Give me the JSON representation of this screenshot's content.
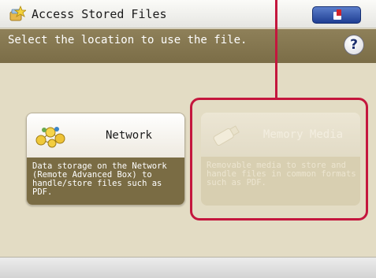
{
  "header": {
    "title": "Access Stored Files",
    "title_icon": "folder-star-icon",
    "top_button_icon": "device-status-icon"
  },
  "instruction": {
    "text": "Select the location to use the file.",
    "help_label": "?"
  },
  "options": [
    {
      "label": "Network",
      "description": "Data storage on the Network (Remote Advanced Box) to handle/store files such as PDF.",
      "icon": "network-icon",
      "enabled": true
    },
    {
      "label": "Memory Media",
      "description": "Removable media to store and handle files in common formats such as PDF.",
      "icon": "usb-memory-icon",
      "enabled": false
    }
  ],
  "colors": {
    "background": "#e3dcc4",
    "instruction_bar": "#7b6d47",
    "highlight": "#c4163d",
    "button": "#1f3f93"
  }
}
